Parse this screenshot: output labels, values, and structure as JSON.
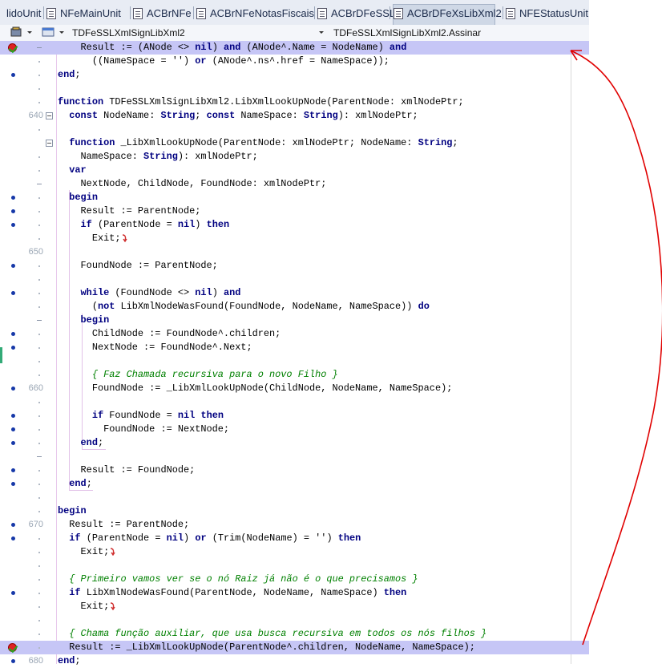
{
  "tabs": [
    {
      "label": "lidoUnit",
      "icon": "none",
      "active": false
    },
    {
      "label": "NFeMainUnit",
      "icon": "file-icon",
      "active": false
    },
    {
      "label": "ACBrNFe",
      "icon": "file-icon",
      "active": false
    },
    {
      "label": "ACBrNFeNotasFiscais",
      "icon": "file-icon",
      "active": false
    },
    {
      "label": "ACBrDFeSSL",
      "icon": "file-icon",
      "active": false
    },
    {
      "label": "ACBrDFeXsLibXml2",
      "icon": "file-icon",
      "active": true
    },
    {
      "label": "NFEStatusUnit",
      "icon": "file-icon",
      "active": false
    }
  ],
  "toolbar": {
    "class_combo": "TDFeSSLXmlSignLibXml2",
    "method_combo": "TDFeSSLXmlSignLibXml2.Assinar"
  },
  "lines": [
    {
      "num": "",
      "marker": "breakpoint",
      "hl": true,
      "gutter": "dash",
      "segs": [
        [
          "",
          "    Result := (ANode <> "
        ],
        [
          "kw",
          "nil"
        ],
        [
          "",
          ") "
        ],
        [
          "kw",
          "and"
        ],
        [
          "",
          " (ANode^.Name = NodeName) "
        ],
        [
          "kw",
          "and"
        ]
      ]
    },
    {
      "num": "",
      "marker": "",
      "gutter": "tick",
      "segs": [
        [
          "",
          "      ((NameSpace = '') "
        ],
        [
          "kw",
          "or"
        ],
        [
          "",
          " (ANode^.ns^.href = NameSpace));"
        ]
      ]
    },
    {
      "num": "",
      "marker": "dot",
      "gutter": "tick",
      "segs": [
        [
          "kw",
          "end"
        ],
        [
          "",
          ";"
        ]
      ]
    },
    {
      "num": "",
      "marker": "",
      "gutter": "tick",
      "segs": []
    },
    {
      "num": "",
      "marker": "",
      "gutter": "tick",
      "segs": [
        [
          "kw",
          "function"
        ],
        [
          "",
          " TDFeSSLXmlSignLibXml2.LibXmlLookUpNode(ParentNode: xmlNodePtr;"
        ]
      ]
    },
    {
      "num": "640",
      "marker": "",
      "gutter": "fold",
      "segs": [
        [
          "",
          "  "
        ],
        [
          "kw",
          "const"
        ],
        [
          "",
          " NodeName: "
        ],
        [
          "kw",
          "String"
        ],
        [
          "",
          "; "
        ],
        [
          "kw",
          "const"
        ],
        [
          "",
          " NameSpace: "
        ],
        [
          "kw",
          "String"
        ],
        [
          "",
          "): xmlNodePtr;"
        ]
      ]
    },
    {
      "num": "",
      "marker": "",
      "gutter": "tick",
      "segs": []
    },
    {
      "num": "",
      "marker": "",
      "gutter": "fold",
      "segs": [
        [
          "",
          "  "
        ],
        [
          "kw",
          "function"
        ],
        [
          "",
          " _LibXmlLookUpNode(ParentNode: xmlNodePtr; NodeName: "
        ],
        [
          "kw",
          "String"
        ],
        [
          "",
          ";"
        ]
      ]
    },
    {
      "num": "",
      "marker": "",
      "gutter": "tick",
      "segs": [
        [
          "",
          "    NameSpace: "
        ],
        [
          "kw",
          "String"
        ],
        [
          "",
          "): xmlNodePtr;"
        ]
      ]
    },
    {
      "num": "",
      "marker": "",
      "gutter": "tick",
      "segs": [
        [
          "",
          "  "
        ],
        [
          "kw",
          "var"
        ]
      ]
    },
    {
      "num": "",
      "marker": "",
      "gutter": "dash",
      "segs": [
        [
          "",
          "    NextNode, ChildNode, FoundNode: xmlNodePtr;"
        ]
      ]
    },
    {
      "num": "",
      "marker": "dot",
      "gutter": "tick",
      "segs": [
        [
          "",
          "  "
        ],
        [
          "kw",
          "begin"
        ]
      ]
    },
    {
      "num": "",
      "marker": "dot",
      "gutter": "tick",
      "segs": [
        [
          "",
          "    Result := ParentNode;"
        ]
      ]
    },
    {
      "num": "",
      "marker": "dot",
      "gutter": "tick",
      "segs": [
        [
          "",
          "    "
        ],
        [
          "kw",
          "if"
        ],
        [
          "",
          " (ParentNode = "
        ],
        [
          "kw",
          "nil"
        ],
        [
          "",
          ") "
        ],
        [
          "kw",
          "then"
        ]
      ]
    },
    {
      "num": "",
      "marker": "",
      "gutter": "tick",
      "exit": true,
      "segs": [
        [
          "",
          "      Exit;"
        ]
      ]
    },
    {
      "num": "650",
      "marker": "",
      "gutter": "none",
      "segs": []
    },
    {
      "num": "",
      "marker": "dot",
      "gutter": "tick",
      "segs": [
        [
          "",
          "    FoundNode := ParentNode;"
        ]
      ]
    },
    {
      "num": "",
      "marker": "",
      "gutter": "tick",
      "segs": []
    },
    {
      "num": "",
      "marker": "dot",
      "gutter": "tick",
      "segs": [
        [
          "",
          "    "
        ],
        [
          "kw",
          "while"
        ],
        [
          "",
          " (FoundNode <> "
        ],
        [
          "kw",
          "nil"
        ],
        [
          "",
          ") "
        ],
        [
          "kw",
          "and"
        ]
      ]
    },
    {
      "num": "",
      "marker": "",
      "gutter": "tick",
      "segs": [
        [
          "",
          "      ("
        ],
        [
          "kw",
          "not"
        ],
        [
          "",
          " LibXmlNodeWasFound(FoundNode, NodeName, NameSpace)) "
        ],
        [
          "kw",
          "do"
        ]
      ]
    },
    {
      "num": "",
      "marker": "",
      "gutter": "dash",
      "segs": [
        [
          "",
          "    "
        ],
        [
          "kw",
          "begin"
        ]
      ]
    },
    {
      "num": "",
      "marker": "dot",
      "gutter": "tick",
      "segs": [
        [
          "",
          "      ChildNode := FoundNode^.children;"
        ]
      ]
    },
    {
      "num": "",
      "marker": "dot",
      "gutter": "tick",
      "segs": [
        [
          "",
          "      NextNode := FoundNode^.Next;"
        ]
      ]
    },
    {
      "num": "",
      "marker": "",
      "gutter": "tick",
      "segs": []
    },
    {
      "num": "",
      "marker": "",
      "gutter": "tick",
      "segs": [
        [
          "",
          "      "
        ],
        [
          "cm",
          "{ Faz Chamada recursiva para o novo Filho }"
        ]
      ]
    },
    {
      "num": "660",
      "marker": "dot",
      "gutter": "none",
      "segs": [
        [
          "",
          "      FoundNode := _LibXmlLookUpNode(ChildNode, NodeName, NameSpace);"
        ]
      ]
    },
    {
      "num": "",
      "marker": "",
      "gutter": "tick",
      "segs": []
    },
    {
      "num": "",
      "marker": "dot",
      "gutter": "tick",
      "segs": [
        [
          "",
          "      "
        ],
        [
          "kw",
          "if"
        ],
        [
          "",
          " FoundNode = "
        ],
        [
          "kw",
          "nil"
        ],
        [
          "",
          " "
        ],
        [
          "kw",
          "then"
        ]
      ]
    },
    {
      "num": "",
      "marker": "dot",
      "gutter": "tick",
      "segs": [
        [
          "",
          "        FoundNode := NextNode;"
        ]
      ]
    },
    {
      "num": "",
      "marker": "dot",
      "gutter": "tick",
      "segs": [
        [
          "",
          "    "
        ],
        [
          "kw",
          "end"
        ],
        [
          "",
          ";"
        ]
      ]
    },
    {
      "num": "",
      "marker": "",
      "gutter": "dash",
      "segs": []
    },
    {
      "num": "",
      "marker": "dot",
      "gutter": "tick",
      "segs": [
        [
          "",
          "    Result := FoundNode;"
        ]
      ]
    },
    {
      "num": "",
      "marker": "dot",
      "gutter": "tick",
      "segs": [
        [
          "",
          "  "
        ],
        [
          "kw",
          "end"
        ],
        [
          "",
          ";"
        ]
      ]
    },
    {
      "num": "",
      "marker": "",
      "gutter": "tick",
      "segs": []
    },
    {
      "num": "",
      "marker": "",
      "gutter": "tick",
      "segs": [
        [
          "kw",
          "begin"
        ]
      ]
    },
    {
      "num": "670",
      "marker": "dot",
      "gutter": "none",
      "segs": [
        [
          "",
          "  Result := ParentNode;"
        ]
      ]
    },
    {
      "num": "",
      "marker": "dot",
      "gutter": "tick",
      "segs": [
        [
          "",
          "  "
        ],
        [
          "kw",
          "if"
        ],
        [
          "",
          " (ParentNode = "
        ],
        [
          "kw",
          "nil"
        ],
        [
          "",
          ") "
        ],
        [
          "kw",
          "or"
        ],
        [
          "",
          " (Trim(NodeName) = '') "
        ],
        [
          "kw",
          "then"
        ]
      ]
    },
    {
      "num": "",
      "marker": "",
      "gutter": "tick",
      "exit": true,
      "segs": [
        [
          "",
          "    Exit;"
        ]
      ]
    },
    {
      "num": "",
      "marker": "",
      "gutter": "tick",
      "segs": []
    },
    {
      "num": "",
      "marker": "",
      "gutter": "tick",
      "segs": [
        [
          "",
          "  "
        ],
        [
          "cm",
          "{ Primeiro vamos ver se o nó Raiz já não é o que precisamos }"
        ]
      ]
    },
    {
      "num": "",
      "marker": "dot",
      "gutter": "tick",
      "segs": [
        [
          "",
          "  "
        ],
        [
          "kw",
          "if"
        ],
        [
          "",
          " LibXmlNodeWasFound(ParentNode, NodeName, NameSpace) "
        ],
        [
          "kw",
          "then"
        ]
      ]
    },
    {
      "num": "",
      "marker": "",
      "gutter": "tick",
      "exit": true,
      "segs": [
        [
          "",
          "    Exit;"
        ]
      ]
    },
    {
      "num": "",
      "marker": "",
      "gutter": "tick",
      "segs": []
    },
    {
      "num": "",
      "marker": "",
      "gutter": "tick",
      "segs": [
        [
          "",
          "  "
        ],
        [
          "cm",
          "{ Chama função auxiliar, que usa busca recursiva em todos os nós filhos }"
        ]
      ]
    },
    {
      "num": "",
      "marker": "breakpoint",
      "hl": true,
      "gutter": "tick",
      "segs": [
        [
          "",
          "  Result := _LibXmlLookUpNode(ParentNode^.children, NodeName, NameSpace);"
        ]
      ]
    },
    {
      "num": "680",
      "marker": "dot",
      "gutter": "none",
      "segs": [
        [
          "kw",
          "end"
        ],
        [
          "",
          ";"
        ]
      ]
    }
  ]
}
